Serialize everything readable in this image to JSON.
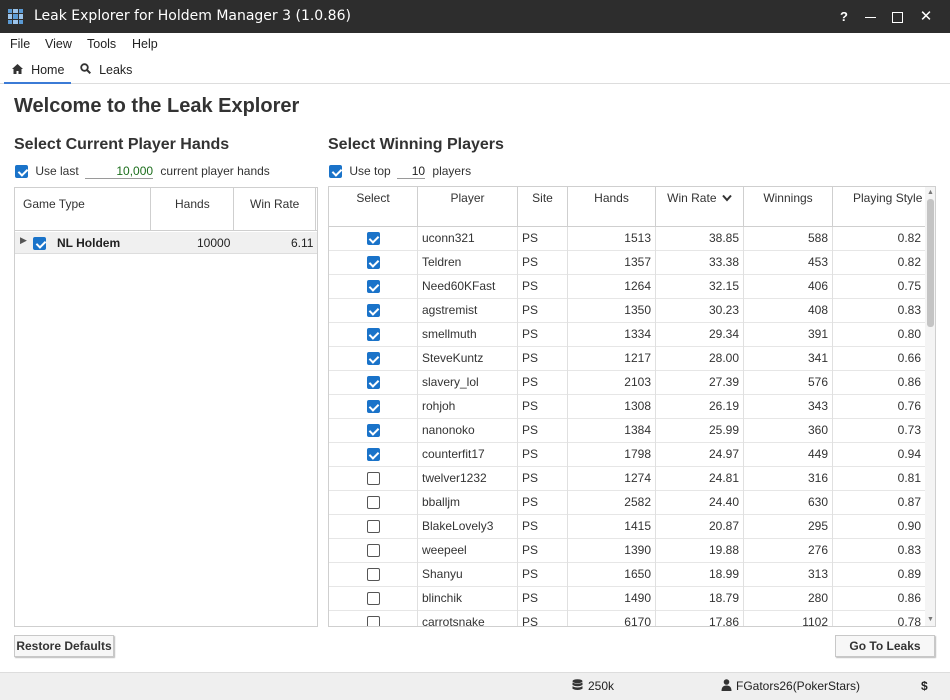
{
  "window": {
    "title": "Leak Explorer for Holdem Manager 3 (1.0.86)",
    "help": "?",
    "close": "✕"
  },
  "menu": [
    "File",
    "View",
    "Tools",
    "Help"
  ],
  "tabs": [
    {
      "label": "Home",
      "icon": "home-icon",
      "active": true
    },
    {
      "label": "Leaks",
      "icon": "search-icon",
      "active": false
    }
  ],
  "page_title": "Welcome to the Leak Explorer",
  "current_hands": {
    "title": "Select Current Player Hands",
    "use_last_label": "Use last",
    "use_last_value": "10,000",
    "suffix": "current player hands",
    "columns": [
      "Game Type",
      "Hands",
      "Win Rate"
    ],
    "rows": [
      {
        "game_type": "NL Holdem",
        "hands": "10000",
        "win_rate": "6.11",
        "checked": true
      }
    ]
  },
  "winners": {
    "title": "Select Winning Players",
    "use_top_label": "Use top",
    "use_top_value": "10",
    "suffix": "players",
    "columns": [
      "Select",
      "Player",
      "Site",
      "Hands",
      "Win Rate",
      "Winnings",
      "Playing Style"
    ],
    "sort_icon": "chevron-down-icon",
    "rows": [
      {
        "checked": true,
        "player": "uconn321",
        "site": "PS",
        "hands": "1513",
        "win_rate": "38.85",
        "winnings": "588",
        "style": "0.82"
      },
      {
        "checked": true,
        "player": "Teldren",
        "site": "PS",
        "hands": "1357",
        "win_rate": "33.38",
        "winnings": "453",
        "style": "0.82"
      },
      {
        "checked": true,
        "player": "Need60KFast",
        "site": "PS",
        "hands": "1264",
        "win_rate": "32.15",
        "winnings": "406",
        "style": "0.75"
      },
      {
        "checked": true,
        "player": "agstremist",
        "site": "PS",
        "hands": "1350",
        "win_rate": "30.23",
        "winnings": "408",
        "style": "0.83"
      },
      {
        "checked": true,
        "player": "smellmuth",
        "site": "PS",
        "hands": "1334",
        "win_rate": "29.34",
        "winnings": "391",
        "style": "0.80"
      },
      {
        "checked": true,
        "player": "SteveKuntz",
        "site": "PS",
        "hands": "1217",
        "win_rate": "28.00",
        "winnings": "341",
        "style": "0.66"
      },
      {
        "checked": true,
        "player": "slavery_lol",
        "site": "PS",
        "hands": "2103",
        "win_rate": "27.39",
        "winnings": "576",
        "style": "0.86"
      },
      {
        "checked": true,
        "player": "rohjoh",
        "site": "PS",
        "hands": "1308",
        "win_rate": "26.19",
        "winnings": "343",
        "style": "0.76"
      },
      {
        "checked": true,
        "player": "nanonoko",
        "site": "PS",
        "hands": "1384",
        "win_rate": "25.99",
        "winnings": "360",
        "style": "0.73"
      },
      {
        "checked": true,
        "player": "counterfit17",
        "site": "PS",
        "hands": "1798",
        "win_rate": "24.97",
        "winnings": "449",
        "style": "0.94"
      },
      {
        "checked": false,
        "player": "twelver1232",
        "site": "PS",
        "hands": "1274",
        "win_rate": "24.81",
        "winnings": "316",
        "style": "0.81"
      },
      {
        "checked": false,
        "player": "bballjm",
        "site": "PS",
        "hands": "2582",
        "win_rate": "24.40",
        "winnings": "630",
        "style": "0.87"
      },
      {
        "checked": false,
        "player": "BlakeLovely3",
        "site": "PS",
        "hands": "1415",
        "win_rate": "20.87",
        "winnings": "295",
        "style": "0.90"
      },
      {
        "checked": false,
        "player": "weepeel",
        "site": "PS",
        "hands": "1390",
        "win_rate": "19.88",
        "winnings": "276",
        "style": "0.83"
      },
      {
        "checked": false,
        "player": "Shanyu",
        "site": "PS",
        "hands": "1650",
        "win_rate": "18.99",
        "winnings": "313",
        "style": "0.89"
      },
      {
        "checked": false,
        "player": "blinchik",
        "site": "PS",
        "hands": "1490",
        "win_rate": "18.79",
        "winnings": "280",
        "style": "0.86"
      },
      {
        "checked": false,
        "player": "carrotsnake",
        "site": "PS",
        "hands": "6170",
        "win_rate": "17.86",
        "winnings": "1102",
        "style": "0.78"
      }
    ]
  },
  "buttons": {
    "restore": "Restore Defaults",
    "go": "Go To Leaks"
  },
  "status": {
    "db_icon": "database-icon",
    "db_size": "250k",
    "user_icon": "user-icon",
    "user": "FGators26(PokerStars)",
    "currency": "$"
  },
  "colors": {
    "accent": "#1a73c9",
    "titlebar": "#2d2d2d",
    "input_text": "#1c6e1c"
  }
}
